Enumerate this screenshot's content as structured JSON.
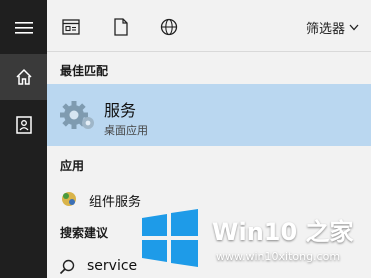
{
  "rail": {
    "items": [
      {
        "icon": "hamburger-menu-icon"
      },
      {
        "icon": "home-icon"
      },
      {
        "icon": "notebook-icon"
      }
    ]
  },
  "toolbar": {
    "filter_label": "筛选器",
    "icons": [
      "apps-icon",
      "document-icon",
      "web-icon"
    ]
  },
  "sections": {
    "best_match": "最佳匹配",
    "apps": "应用",
    "search_suggestions": "搜索建议"
  },
  "best_match": {
    "title": "服务",
    "subtitle": "桌面应用",
    "icon": "services-gear-icon"
  },
  "apps": [
    {
      "label": "组件服务",
      "icon": "component-services-icon"
    }
  ],
  "suggestions": [
    {
      "label": "service",
      "icon": "search-icon"
    }
  ],
  "watermark": {
    "brand": "Win10 之家",
    "url": "www.win10xitong.com"
  },
  "colors": {
    "rail_bg": "#1f1f1f",
    "selected_bg": "#bad7f0",
    "logo_blue": "#1e9be8"
  }
}
